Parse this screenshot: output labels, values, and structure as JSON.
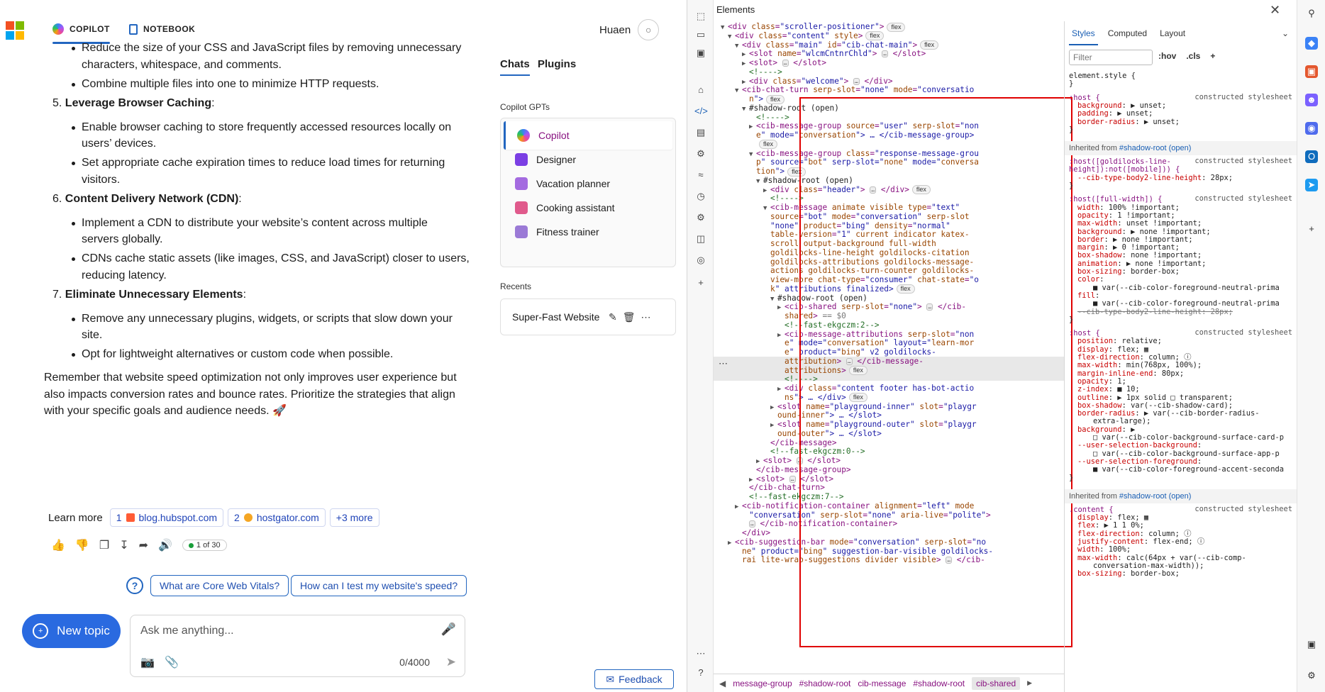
{
  "app": {
    "tabs": [
      {
        "label": "COPILOT"
      },
      {
        "label": "NOTEBOOK"
      }
    ],
    "user_name": "Huaen",
    "chat": {
      "lines": [
        {
          "type": "sub",
          "text": "Reduce the size of your CSS and JavaScript files by removing unnecessary"
        },
        {
          "type": "cont",
          "text": "characters, whitespace, and comments."
        },
        {
          "type": "sub",
          "text": "Combine multiple files into one to minimize HTTP requests."
        },
        {
          "type": "num",
          "prefix": "5.",
          "bold": "Leverage Browser Caching",
          "text": ":"
        },
        {
          "type": "sub",
          "text": "Enable browser caching to store frequently accessed resources locally on"
        },
        {
          "type": "cont",
          "text": "users’ devices."
        },
        {
          "type": "sub",
          "text": "Set appropriate cache expiration times to reduce load times for returning"
        },
        {
          "type": "cont",
          "text": "visitors."
        },
        {
          "type": "num",
          "prefix": "6.",
          "bold": "Content Delivery Network (CDN)",
          "text": ":"
        },
        {
          "type": "sub",
          "text": "Implement a CDN to distribute your website’s content across multiple"
        },
        {
          "type": "cont",
          "text": "servers globally."
        },
        {
          "type": "sub",
          "text": "CDNs cache static assets (like images, CSS, and JavaScript) closer to users,"
        },
        {
          "type": "cont",
          "text": "reducing latency."
        },
        {
          "type": "num",
          "prefix": "7.",
          "bold": "Eliminate Unnecessary Elements",
          "text": ":"
        },
        {
          "type": "sub",
          "text": "Remove any unnecessary plugins, widgets, or scripts that slow down your"
        },
        {
          "type": "cont",
          "text": "site."
        },
        {
          "type": "sub",
          "text": "Opt for lightweight alternatives or custom code when possible."
        },
        {
          "type": "para",
          "text": "Remember that website speed optimization not only improves user experience but"
        },
        {
          "type": "para",
          "text": "also impacts conversion rates and bounce rates. Prioritize the strategies that align"
        },
        {
          "type": "para",
          "text": "with your specific goals and audience needs. 🚀"
        }
      ]
    },
    "learn_more": {
      "label": "Learn more",
      "citations": [
        {
          "num": "1",
          "text": "blog.hubspot.com"
        },
        {
          "num": "2",
          "text": "hostgator.com"
        }
      ],
      "more": "+3 more"
    },
    "turn_counter": "1 of 30",
    "suggestions": [
      "What are Core Web Vitals?",
      "How can I test my website's speed?"
    ],
    "new_topic": "New topic",
    "input": {
      "placeholder": "Ask me anything...",
      "char_count": "0/4000"
    },
    "feedback": "Feedback",
    "panel": {
      "tabs": [
        {
          "label": "Chats"
        },
        {
          "label": "Plugins"
        }
      ],
      "gpts_label": "Copilot GPTs",
      "gpts": [
        {
          "name": "Copilot",
          "color": "#8a5cf6"
        },
        {
          "name": "Designer",
          "color": "#7b3fe4"
        },
        {
          "name": "Vacation planner",
          "color": "#a46be0"
        },
        {
          "name": "Cooking assistant",
          "color": "#e05a8c"
        },
        {
          "name": "Fitness trainer",
          "color": "#9b7ad6"
        }
      ],
      "recents_label": "Recents",
      "recents": [
        {
          "title": "Super-Fast Website"
        }
      ]
    }
  },
  "devtools": {
    "title": "Elements",
    "dom_lines": [
      {
        "indent": 0,
        "arrow": "▼",
        "html": "<div class=\"scroller-positioner\">",
        "badge": "flex"
      },
      {
        "indent": 1,
        "arrow": "▼",
        "html": "<div class=\"content\" style>",
        "badge": "flex"
      },
      {
        "indent": 2,
        "arrow": "▼",
        "html": "<div class=\"main\" id=\"cib-chat-main\">",
        "badge": "flex"
      },
      {
        "indent": 3,
        "arrow": "▶",
        "html": "<slot name=\"wlcmCntnrChld\"> … </slot>"
      },
      {
        "indent": 3,
        "arrow": "▶",
        "html": "<slot> … </slot>"
      },
      {
        "indent": 3,
        "arrow": "",
        "html": "<!---->",
        "comment": true
      },
      {
        "indent": 3,
        "arrow": "▶",
        "html": "<div class=\"welcome\"> … </div>"
      },
      {
        "indent": 2,
        "arrow": "▼",
        "html": "<cib-chat-turn serp-slot=\"none\" mode=\"conversatio"
      },
      {
        "indent": 3,
        "arrow": "",
        "html": "n\">",
        "badge": "flex"
      },
      {
        "indent": 3,
        "arrow": "▼",
        "html": "#shadow-root (open)",
        "plain": true
      },
      {
        "indent": 4,
        "arrow": "",
        "html": "<!---->",
        "comment": true
      },
      {
        "indent": 4,
        "arrow": "▶",
        "html": "<cib-message-group source=\"user\" serp-slot=\"non"
      },
      {
        "indent": 4,
        "arrow": "",
        "html": "e\" mode=\"conversation\"> … </cib-message-group>"
      },
      {
        "indent": 4,
        "arrow": "",
        "html": "",
        "badge": "flex"
      },
      {
        "indent": 4,
        "arrow": "▼",
        "html": "<cib-message-group class=\"response-message-grou"
      },
      {
        "indent": 4,
        "arrow": "",
        "html": "p\" source=\"bot\" serp-slot=\"none\" mode=\"conversa"
      },
      {
        "indent": 4,
        "arrow": "",
        "html": "tion\">",
        "badge": "flex"
      },
      {
        "indent": 5,
        "arrow": "▼",
        "html": "#shadow-root (open)",
        "plain": true
      },
      {
        "indent": 6,
        "arrow": "▶",
        "html": "<div class=\"header\"> … </div>",
        "badge": "flex"
      },
      {
        "indent": 6,
        "arrow": "",
        "html": "<!---->",
        "comment": true
      },
      {
        "indent": 6,
        "arrow": "▼",
        "html": "<cib-message animate visible type=\"text\""
      },
      {
        "indent": 6,
        "arrow": "",
        "html": "source=\"bot\" mode=\"conversation\" serp-slot="
      },
      {
        "indent": 6,
        "arrow": "",
        "html": "\"none\" product=\"bing\" density=\"normal\""
      },
      {
        "indent": 6,
        "arrow": "",
        "html": "table-version=\"1\" current indicator katex-"
      },
      {
        "indent": 6,
        "arrow": "",
        "html": "scroll output-background full-width"
      },
      {
        "indent": 6,
        "arrow": "",
        "html": "goldilocks-line-height goldilocks-citation"
      },
      {
        "indent": 6,
        "arrow": "",
        "html": "goldilocks-attributions goldilocks-message-"
      },
      {
        "indent": 6,
        "arrow": "",
        "html": "actions goldilocks-turn-counter goldilocks-"
      },
      {
        "indent": 6,
        "arrow": "",
        "html": "view-more chat-type=\"consumer\" chat-state=\"o"
      },
      {
        "indent": 6,
        "arrow": "",
        "html": "k\" attributions finalized>",
        "badge": "flex"
      },
      {
        "indent": 7,
        "arrow": "▼",
        "html": "#shadow-root (open)",
        "plain": true
      },
      {
        "indent": 8,
        "arrow": "▶",
        "html": "<cib-shared serp-slot=\"none\"> … </cib-"
      },
      {
        "indent": 8,
        "arrow": "",
        "html": "shared> == $0"
      },
      {
        "indent": 8,
        "arrow": "",
        "html": "<!--fast-ekgczm:2-->",
        "comment": true
      },
      {
        "indent": 8,
        "arrow": "▶",
        "html": "<cib-message-attributions serp-slot=\"non"
      },
      {
        "indent": 8,
        "arrow": "",
        "html": "e\" mode=\"conversation\" layout=\"learn-mor"
      },
      {
        "indent": 8,
        "arrow": "",
        "html": "e\" product=\"bing\" v2 goldilocks-"
      },
      {
        "indent": 8,
        "arrow": "",
        "html": "attribution> … </cib-message-"
      },
      {
        "indent": 8,
        "arrow": "",
        "html": "attributions>",
        "badge": "flex"
      },
      {
        "indent": 8,
        "arrow": "",
        "html": "<!---->",
        "comment": true
      },
      {
        "indent": 8,
        "arrow": "▶",
        "html": "<div class=\"content footer has-bot-actio"
      },
      {
        "indent": 8,
        "arrow": "",
        "html": "ns\"> … </div>",
        "badge": "flex"
      },
      {
        "indent": 7,
        "arrow": "▶",
        "html": "<slot name=\"playground-inner\" slot=\"playgr"
      },
      {
        "indent": 7,
        "arrow": "",
        "html": "ound-inner\"> … </slot>"
      },
      {
        "indent": 7,
        "arrow": "▶",
        "html": "<slot name=\"playground-outer\" slot=\"playgr"
      },
      {
        "indent": 7,
        "arrow": "",
        "html": "ound-outer\"> … </slot>"
      },
      {
        "indent": 6,
        "arrow": "",
        "html": "</cib-message>"
      },
      {
        "indent": 6,
        "arrow": "",
        "html": "<!--fast-ekgczm:0-->",
        "comment": true
      },
      {
        "indent": 5,
        "arrow": "▶",
        "html": "<slot> … </slot>"
      },
      {
        "indent": 4,
        "arrow": "",
        "html": "</cib-message-group>"
      },
      {
        "indent": 4,
        "arrow": "▶",
        "html": "<slot> … </slot>"
      },
      {
        "indent": 3,
        "arrow": "",
        "html": "</cib-chat-turn>"
      },
      {
        "indent": 3,
        "arrow": "",
        "html": "<!--fast-ekgczm:7-->",
        "comment": true
      },
      {
        "indent": 2,
        "arrow": "▶",
        "html": "<cib-notification-container alignment=\"left\" mode="
      },
      {
        "indent": 3,
        "arrow": "",
        "html": "\"conversation\" serp-slot=\"none\" aria-live=\"polite\">"
      },
      {
        "indent": 3,
        "arrow": "",
        "html": "… </cib-notification-container>"
      },
      {
        "indent": 2,
        "arrow": "",
        "html": "</div>"
      },
      {
        "indent": 1,
        "arrow": "▶",
        "html": "<cib-suggestion-bar mode=\"conversation\" serp-slot=\"no"
      },
      {
        "indent": 2,
        "arrow": "",
        "html": "ne\" product=\"bing\" suggestion-bar-visible goldilocks-"
      },
      {
        "indent": 2,
        "arrow": "",
        "html": "rai lite-wrap-suggestions divider visible> … </cib-"
      }
    ],
    "breadcrumbs": [
      "message-group",
      "#shadow-root",
      "cib-message",
      "#shadow-root",
      "cib-shared"
    ],
    "styles": {
      "tabs": [
        "Styles",
        "Computed",
        "Layout"
      ],
      "filter_placeholder": "Filter",
      "tools": [
        ":hov",
        ".cls",
        "+"
      ],
      "lines": [
        {
          "kind": "rule",
          "text": "element.style {"
        },
        {
          "kind": "rule",
          "text": "}"
        },
        {
          "kind": "sel",
          "text": ":host {",
          "src": "constructed stylesheet"
        },
        {
          "kind": "prop",
          "text": "background: ▶ unset;"
        },
        {
          "kind": "prop",
          "text": "padding: ▶ unset;"
        },
        {
          "kind": "prop",
          "text": "border-radius: ▶ unset;"
        },
        {
          "kind": "rule",
          "text": "}"
        },
        {
          "kind": "inh",
          "text": "Inherited from ",
          "link": "#shadow-root (open)"
        },
        {
          "kind": "sel",
          "text": ":host([goldilocks-line-",
          "src": "constructed stylesheet"
        },
        {
          "kind": "sel",
          "text": "height]):not([mobile])) {"
        },
        {
          "kind": "prop",
          "text": "--cib-type-body2-line-height: 28px;"
        },
        {
          "kind": "rule",
          "text": "}"
        },
        {
          "kind": "sel",
          "text": ":host([full-width]) {",
          "src": "constructed stylesheet"
        },
        {
          "kind": "prop",
          "text": "width: 100% !important;"
        },
        {
          "kind": "prop",
          "text": "opacity: 1 !important;"
        },
        {
          "kind": "prop",
          "text": "max-width: unset !important;"
        },
        {
          "kind": "prop",
          "text": "background: ▶ none !important;"
        },
        {
          "kind": "prop",
          "text": "border: ▶ none !important;"
        },
        {
          "kind": "prop",
          "text": "margin: ▶ 0 !important;"
        },
        {
          "kind": "prop",
          "text": "box-shadow: none !important;"
        },
        {
          "kind": "prop",
          "text": "animation: ▶ none !important;"
        },
        {
          "kind": "prop",
          "text": "box-sizing: border-box;"
        },
        {
          "kind": "prop",
          "text": "color:"
        },
        {
          "kind": "prop2",
          "text": "■ var(--cib-color-foreground-neutral-prima"
        },
        {
          "kind": "prop",
          "text": "fill:"
        },
        {
          "kind": "prop2",
          "text": "■ var(--cib-color-foreground-neutral-prima"
        },
        {
          "kind": "strike",
          "text": "--cib-type-body2-line-height: 28px;"
        },
        {
          "kind": "rule",
          "text": "}"
        },
        {
          "kind": "sel",
          "text": ":host {",
          "src": "constructed stylesheet"
        },
        {
          "kind": "prop",
          "text": "position: relative;"
        },
        {
          "kind": "prop",
          "text": "display: flex; ▦"
        },
        {
          "kind": "prop",
          "text": "flex-direction: column; ⓘ"
        },
        {
          "kind": "prop",
          "text": "max-width: min(768px, 100%);"
        },
        {
          "kind": "prop",
          "text": "margin-inline-end: 80px;"
        },
        {
          "kind": "prop",
          "text": "opacity: 1;"
        },
        {
          "kind": "prop",
          "text": "z-index: ■ 10;"
        },
        {
          "kind": "prop",
          "text": "outline: ▶ 1px solid □ transparent;"
        },
        {
          "kind": "prop",
          "text": "box-shadow: var(--cib-shadow-card);"
        },
        {
          "kind": "prop",
          "text": "border-radius: ▶ var(--cib-border-radius-"
        },
        {
          "kind": "prop2",
          "text": " extra-large);"
        },
        {
          "kind": "prop",
          "text": "background: ▶"
        },
        {
          "kind": "prop2",
          "text": "□ var(--cib-color-background-surface-card-p"
        },
        {
          "kind": "prop",
          "text": "--user-selection-background:"
        },
        {
          "kind": "prop2",
          "text": "□ var(--cib-color-background-surface-app-p"
        },
        {
          "kind": "prop",
          "text": "--user-selection-foreground:"
        },
        {
          "kind": "prop2",
          "text": "■ var(--cib-color-foreground-accent-seconda"
        },
        {
          "kind": "rule",
          "text": "}"
        },
        {
          "kind": "inh",
          "text": "Inherited from ",
          "link": "#shadow-root (open)"
        },
        {
          "kind": "sel",
          "text": ".content {",
          "src": "constructed stylesheet"
        },
        {
          "kind": "prop",
          "text": "display: flex; ▦"
        },
        {
          "kind": "prop",
          "text": "flex: ▶ 1 1 0%;"
        },
        {
          "kind": "prop",
          "text": "flex-direction: column; ⓘ"
        },
        {
          "kind": "prop",
          "text": "justify-content: flex-end; ⓘ"
        },
        {
          "kind": "prop",
          "text": "width: 100%;"
        },
        {
          "kind": "prop",
          "text": "max-width: calc(64px + var(--cib-comp-"
        },
        {
          "kind": "prop2",
          "text": " conversation-max-width));"
        },
        {
          "kind": "prop",
          "text": "box-sizing: border-box;"
        }
      ]
    }
  }
}
